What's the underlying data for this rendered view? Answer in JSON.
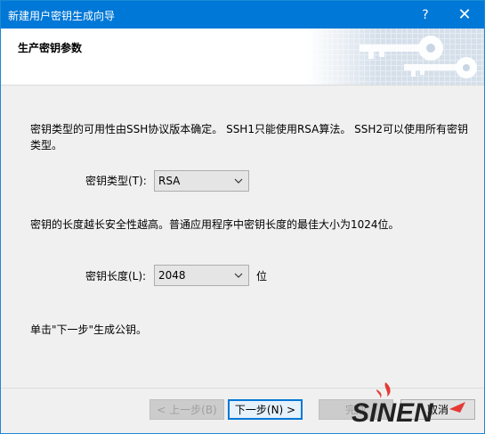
{
  "window": {
    "title": "新建用户密钥生成向导",
    "help_label": "?",
    "close_label": "✕"
  },
  "header": {
    "heading": "生产密钥参数"
  },
  "main": {
    "description": "密钥类型的可用性由SSH协议版本确定。 SSH1只能使用RSA算法。 SSH2可以使用所有密钥类型。",
    "key_type_label": "密钥类型(T):",
    "key_type_value": "RSA",
    "length_description": "密钥的长度越长安全性越高。普通应用程序中密钥长度的最佳大小为1024位。",
    "key_length_label": "密钥长度(L):",
    "key_length_value": "2048",
    "key_length_unit": "位",
    "hint": "单击\"下一步\"生成公钥。"
  },
  "footer": {
    "back_label": "< 上一步(B)",
    "next_label": "下一步(N) >",
    "finish_label": "完成",
    "cancel_label": "取消"
  },
  "watermark": {
    "text": "SINEN"
  },
  "colors": {
    "titlebar": "#0078d7",
    "accent": "#0078d7",
    "watermark_red": "#e53935"
  }
}
